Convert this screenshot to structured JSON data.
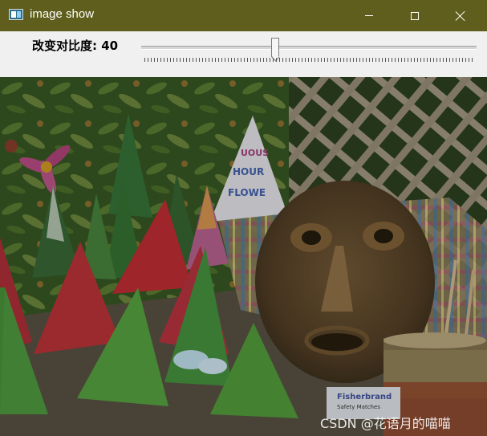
{
  "window": {
    "title": "image show",
    "app_icon": "opencv-window-icon",
    "controls": [
      "minimize-icon",
      "maximize-icon",
      "close-icon"
    ]
  },
  "trackbar": {
    "label": "改变对比度",
    "value": "40",
    "position_fraction": 0.4
  },
  "image": {
    "description_icon": "party-hats-photo",
    "packaging_text": "Fisherbrand",
    "packaging_subtext": "Safety Matches",
    "hat_text": "UOUS HOUR FLOWE"
  },
  "watermark": "CSDN @花语月的喵喵",
  "colors": {
    "titlebar": "#5f5e1c",
    "panel": "#f0f0f0"
  }
}
